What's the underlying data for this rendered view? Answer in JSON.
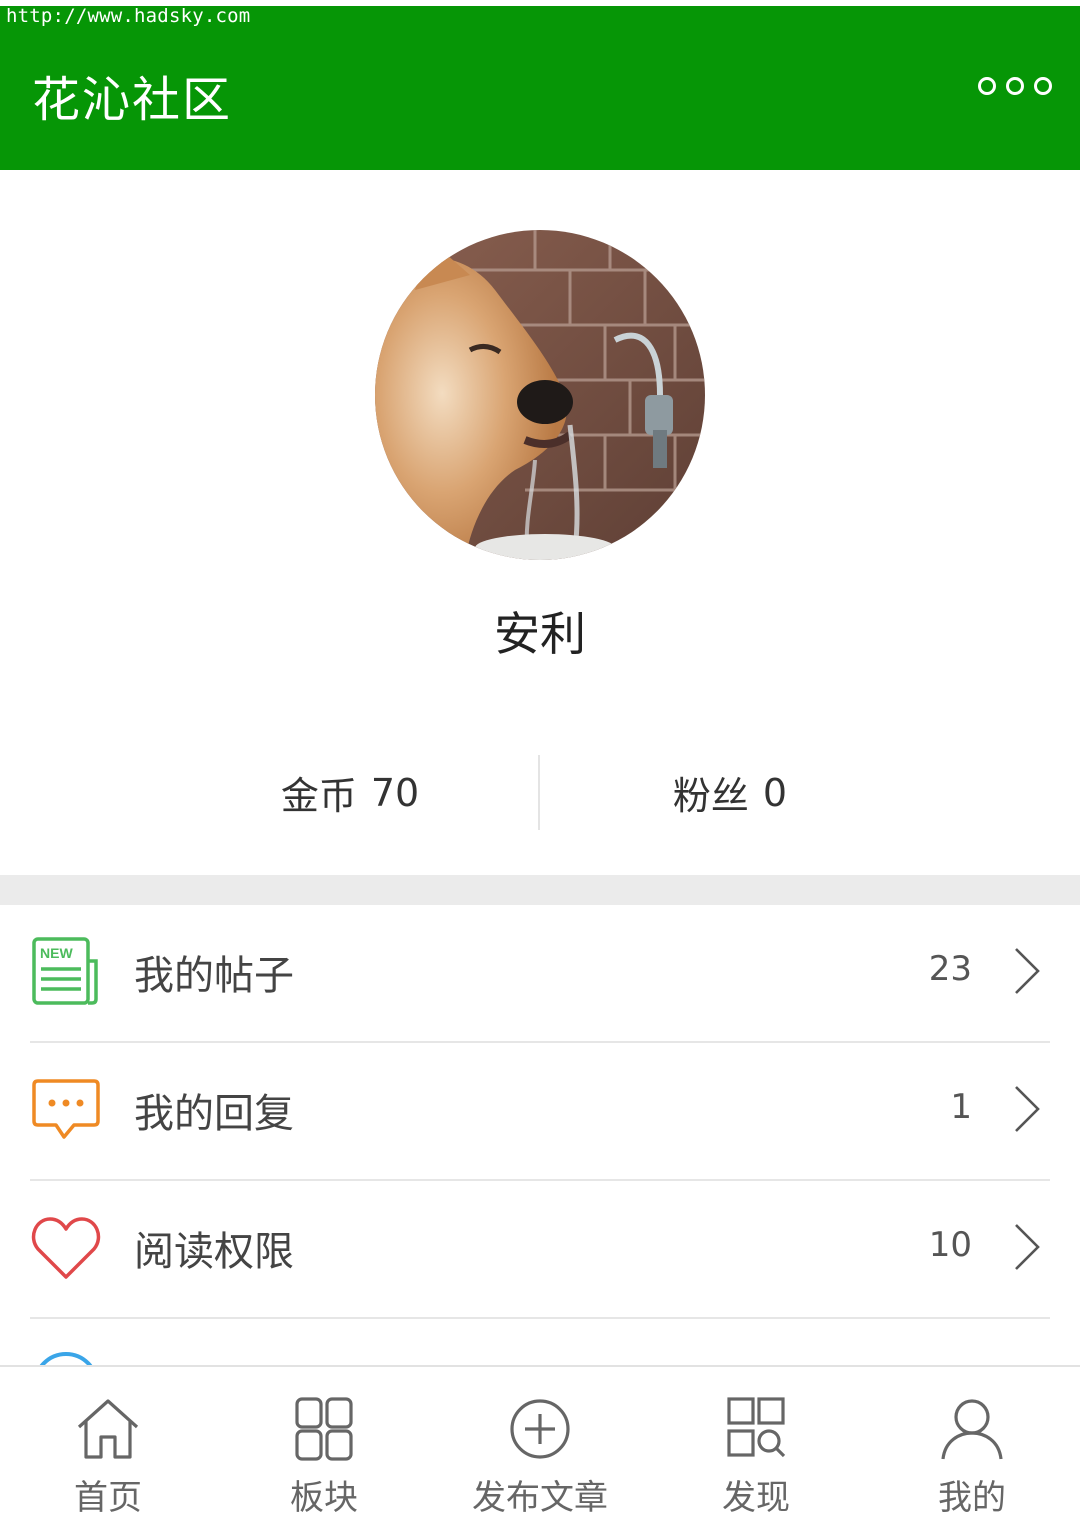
{
  "browser": {
    "url": "http://www.hadsky.com"
  },
  "header": {
    "title": "花沁社区",
    "more_icon": "more-dots-icon"
  },
  "colors": {
    "brand": "#069606",
    "new_icon": "#4cbb5c",
    "reply_icon": "#ef8a24",
    "heart_icon": "#e0484a",
    "partial_icon": "#3aa5e8"
  },
  "profile": {
    "username": "安利",
    "stats": [
      {
        "label": "金币",
        "value": "70"
      },
      {
        "label": "粉丝",
        "value": "0"
      }
    ]
  },
  "menu": [
    {
      "label": "我的帖子",
      "count": "23",
      "icon": "newspaper-new-icon"
    },
    {
      "label": "我的回复",
      "count": "1",
      "icon": "chat-bubble-icon"
    },
    {
      "label": "阅读权限",
      "count": "10",
      "icon": "heart-icon"
    }
  ],
  "tabs": [
    {
      "label": "首页",
      "icon": "home-icon"
    },
    {
      "label": "板块",
      "icon": "grid-icon"
    },
    {
      "label": "发布文章",
      "icon": "plus-circle-icon"
    },
    {
      "label": "发现",
      "icon": "discover-icon"
    },
    {
      "label": "我的",
      "icon": "user-icon"
    }
  ]
}
